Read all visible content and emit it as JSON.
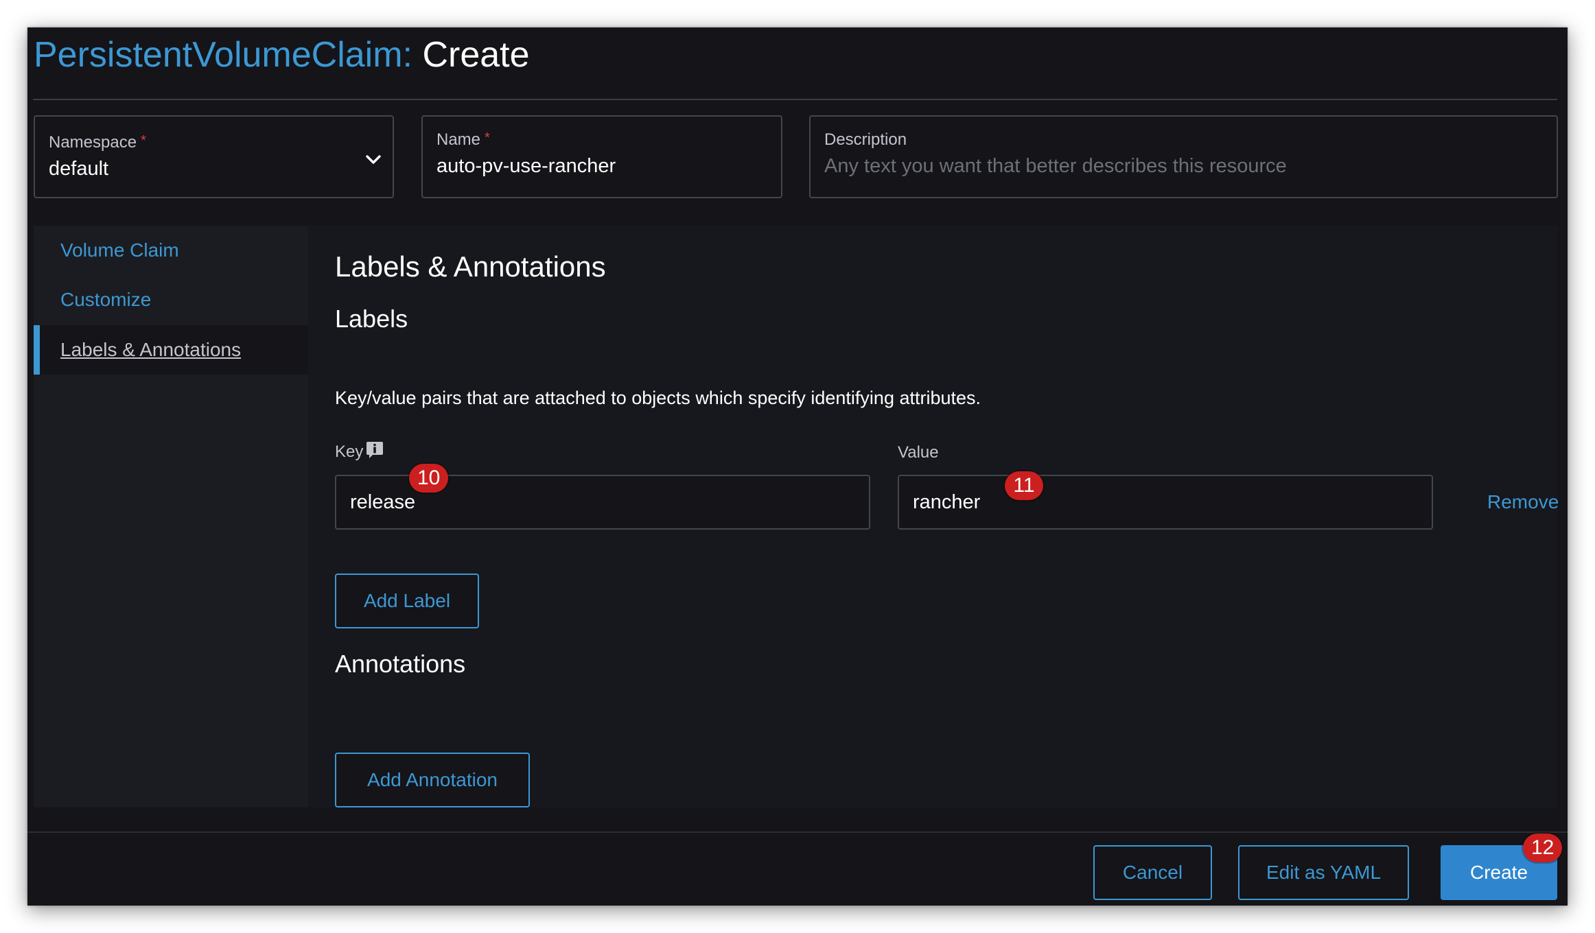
{
  "header": {
    "resource": "PersistentVolumeClaim:",
    "action": "Create"
  },
  "form": {
    "namespace": {
      "label": "Namespace",
      "required_mark": "*",
      "value": "default"
    },
    "name": {
      "label": "Name",
      "required_mark": "*",
      "value": "auto-pv-use-rancher"
    },
    "description": {
      "label": "Description",
      "placeholder": "Any text you want that better describes this resource"
    }
  },
  "sidebar": {
    "items": [
      {
        "label": "Volume Claim",
        "active": false
      },
      {
        "label": "Customize",
        "active": false
      },
      {
        "label": "Labels & Annotations",
        "active": true
      }
    ]
  },
  "main": {
    "section_title": "Labels & Annotations",
    "labels": {
      "title": "Labels",
      "description": "Key/value pairs that are attached to objects which specify identifying attributes.",
      "key_column": "Key",
      "value_column": "Value",
      "rows": [
        {
          "key": "release",
          "value": "rancher",
          "remove_label": "Remove"
        }
      ],
      "add_button": "Add Label"
    },
    "annotations": {
      "title": "Annotations",
      "add_button": "Add Annotation"
    }
  },
  "footer": {
    "cancel": "Cancel",
    "edit_yaml": "Edit as YAML",
    "create": "Create"
  },
  "badges": {
    "key_input": "10",
    "value_input": "11",
    "create_button": "12"
  },
  "colors": {
    "background": "#141419",
    "accent": "#3d98d3",
    "primary_button": "#2f86cf",
    "badge": "#cc1f1f",
    "required": "#d64343"
  },
  "icons": {
    "namespace_dropdown": "chevron-down-icon",
    "key_info": "info-icon"
  }
}
